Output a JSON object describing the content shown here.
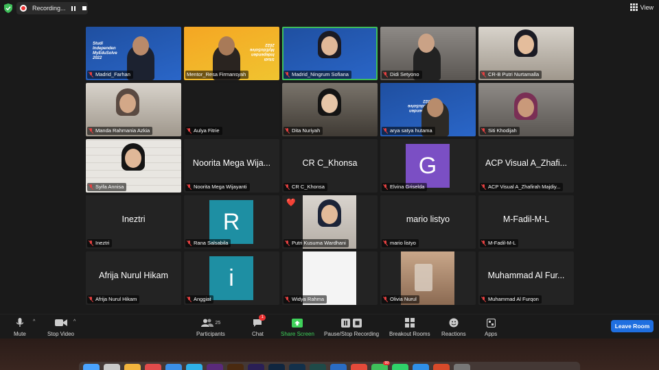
{
  "topbar": {
    "recording_label": "Recording...",
    "view_label": "View"
  },
  "tiles": [
    {
      "name": "Madrid_Farhan"
    },
    {
      "name": "Mentor_Resa Firmansyah"
    },
    {
      "name": "Madrid_Ningrum Sofiana"
    },
    {
      "name": "Didi Setyono"
    },
    {
      "name": "CR-B Putri Nurtamalla"
    },
    {
      "name": "Manda Rahmania Azkia"
    },
    {
      "name": "Aulya Fitrie"
    },
    {
      "name": "Dita Nuriyah"
    },
    {
      "name": "arya satya hutama"
    },
    {
      "name": "Siti Khodijah"
    },
    {
      "name": "Syifa Annisa"
    },
    {
      "name": "Noorita Mega Wijayanti",
      "display": "Noorita Mega Wija..."
    },
    {
      "name": "CR C_Khonsa",
      "display": "CR C_Khonsa"
    },
    {
      "name": "Elvina Griselda",
      "avatar_letter": "G",
      "avatar_color": "#7b4fc4"
    },
    {
      "name": "ACP Visual A_Zhafirah Majdiy...",
      "display": "ACP Visual A_Zhafi..."
    },
    {
      "name": "Ineztri",
      "display": "Ineztri"
    },
    {
      "name": "Rana Salsabila",
      "avatar_letter": "R",
      "avatar_color": "#1e8fa3"
    },
    {
      "name": "Putri Kusuma Wardhani",
      "reaction": "❤️"
    },
    {
      "name": "mario listyo",
      "display": "mario listyo"
    },
    {
      "name": "M-Fadil-M-L",
      "display": "M-Fadil-M-L"
    },
    {
      "name": "Afrija Nurul Hikam",
      "display": "Afrija Nurul Hikam"
    },
    {
      "name": "Anggiat",
      "avatar_letter": "i",
      "avatar_color": "#1e8fa3"
    },
    {
      "name": "Widya Rahma"
    },
    {
      "name": "Olivia Nurul"
    },
    {
      "name": "Muhammad Al Furqon",
      "display": "Muhammad Al Fur..."
    }
  ],
  "banner": {
    "text_blue": "Studi\nIndependen\nMyEduSolve\n2022",
    "text_orange": "Studi\nIndependen\nMyEduSolve\n2022"
  },
  "toolbar": {
    "mute": "Mute",
    "stop_video": "Stop Video",
    "participants": "Participants",
    "participants_count": "25",
    "chat": "Chat",
    "chat_badge": "1",
    "share_screen": "Share Screen",
    "record": "Pause/Stop Recording",
    "breakout": "Breakout Rooms",
    "reactions": "Reactions",
    "apps": "Apps",
    "leave": "Leave Room"
  },
  "dock_badge": "99",
  "colors": {
    "accent_green": "#3fd15a",
    "leave_blue": "#1f6fe0",
    "mute_red": "#e54040"
  }
}
